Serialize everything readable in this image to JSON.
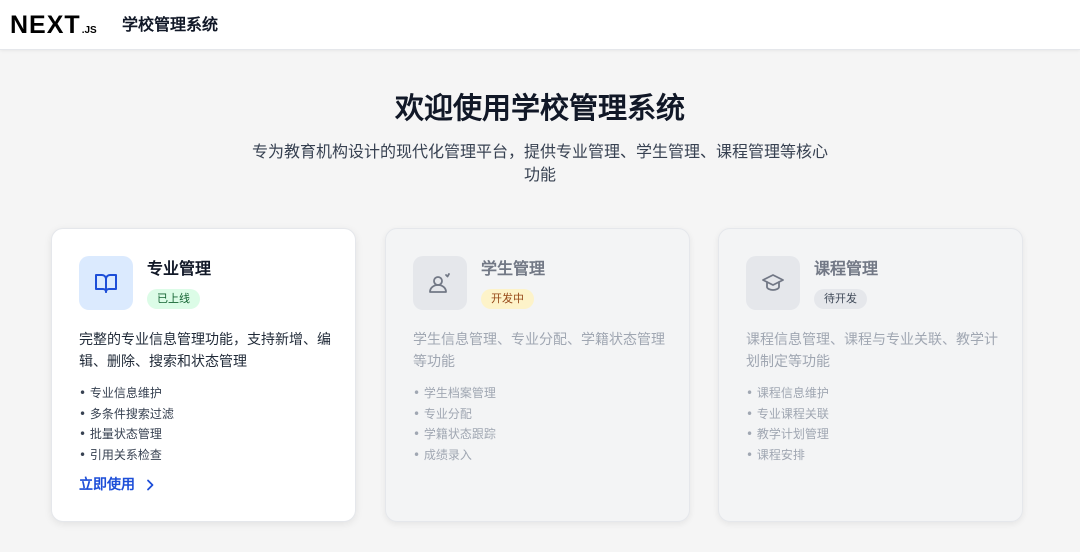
{
  "header": {
    "logo_main": "NEXT",
    "logo_sub": ".JS",
    "app_title": "学校管理系统"
  },
  "hero": {
    "title": "欢迎使用学校管理系统",
    "subtitle": "专为教育机构设计的现代化管理平台，提供专业管理、学生管理、课程管理等核心功能"
  },
  "cards": [
    {
      "icon": "book-open-icon",
      "title": "专业管理",
      "badge": "已上线",
      "badge_color": "#dcfce7",
      "description": "完整的专业信息管理功能，支持新增、编辑、删除、搜索和状态管理",
      "features": [
        "• 专业信息维护",
        "• 多条件搜索过滤",
        "• 批量状态管理",
        "• 引用关系检查"
      ],
      "cta": "立即使用"
    },
    {
      "icon": "user-icon",
      "title": "学生管理",
      "badge": "开发中",
      "badge_color": "#fef3c7",
      "description": "学生信息管理、专业分配、学籍状态管理等功能",
      "features": [
        "• 学生档案管理",
        "• 专业分配",
        "• 学籍状态跟踪",
        "• 成绩录入"
      ]
    },
    {
      "icon": "graduation-cap-icon",
      "title": "课程管理",
      "badge": "待开发",
      "badge_color": "#e5e7eb",
      "description": "课程信息管理、课程与专业关联、教学计划制定等功能",
      "features": [
        "• 课程信息维护",
        "• 专业课程关联",
        "• 教学计划管理",
        "• 课程安排"
      ]
    }
  ],
  "colors": {
    "accent": "#1d4ed8",
    "background": "#f5f5f5",
    "card_active_icon_bg": "#dbeafe"
  }
}
